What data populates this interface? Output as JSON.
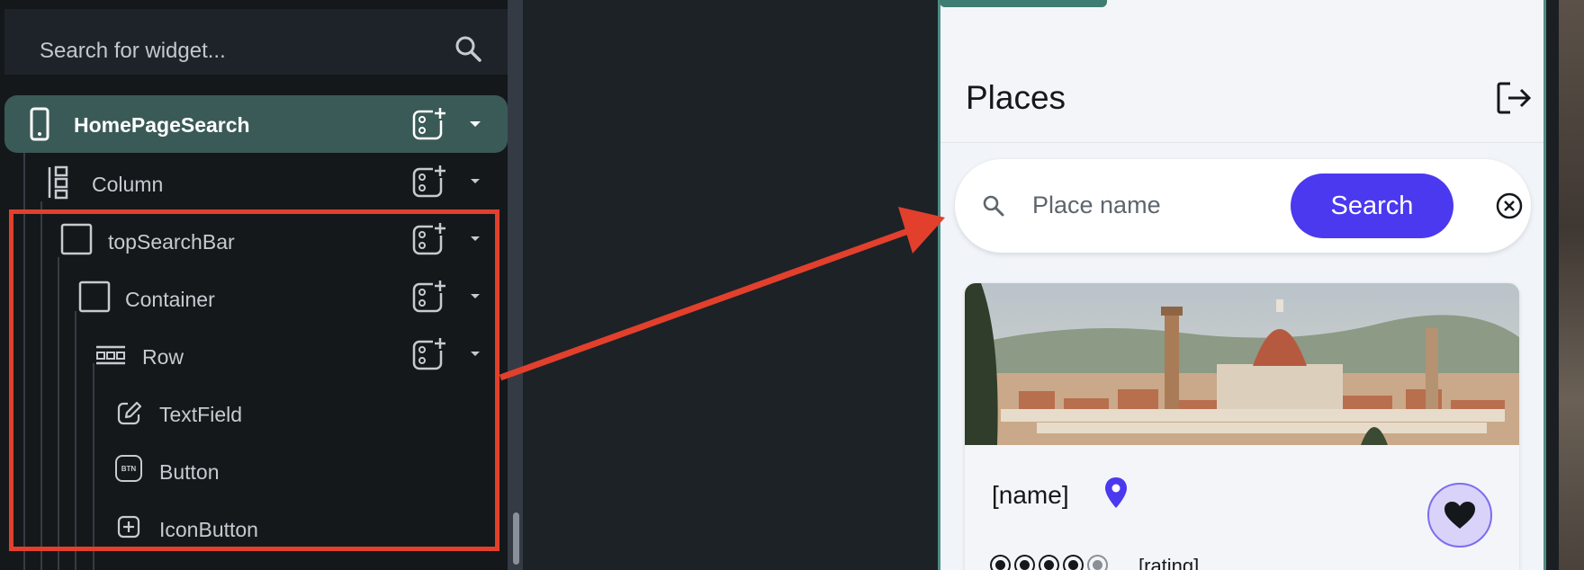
{
  "widget_tree": {
    "search_placeholder": "Search for widget...",
    "items": [
      {
        "label": "HomePageSearch",
        "icon": "phone-icon",
        "selected": true
      },
      {
        "label": "Column",
        "icon": "column-icon"
      },
      {
        "label": "topSearchBar",
        "icon": "container-icon"
      },
      {
        "label": "Container",
        "icon": "container-icon"
      },
      {
        "label": "Row",
        "icon": "row-icon"
      },
      {
        "label": "TextField",
        "icon": "edit-icon"
      },
      {
        "label": "Button",
        "icon": "btn-icon"
      },
      {
        "label": "IconButton",
        "icon": "icon-button-icon"
      }
    ],
    "btn_icon_text": "BTN"
  },
  "preview": {
    "page_title": "Places",
    "search_placeholder": "Place name",
    "search_button": "Search",
    "card": {
      "name": "[name]",
      "rating": "[rating]",
      "stars_filled": 4,
      "stars_total": 5
    }
  },
  "colors": {
    "highlight": "#e2402c",
    "selected_row": "#3a5a57",
    "primary": "#4b39ef",
    "phone_border": "#4d8c86"
  }
}
